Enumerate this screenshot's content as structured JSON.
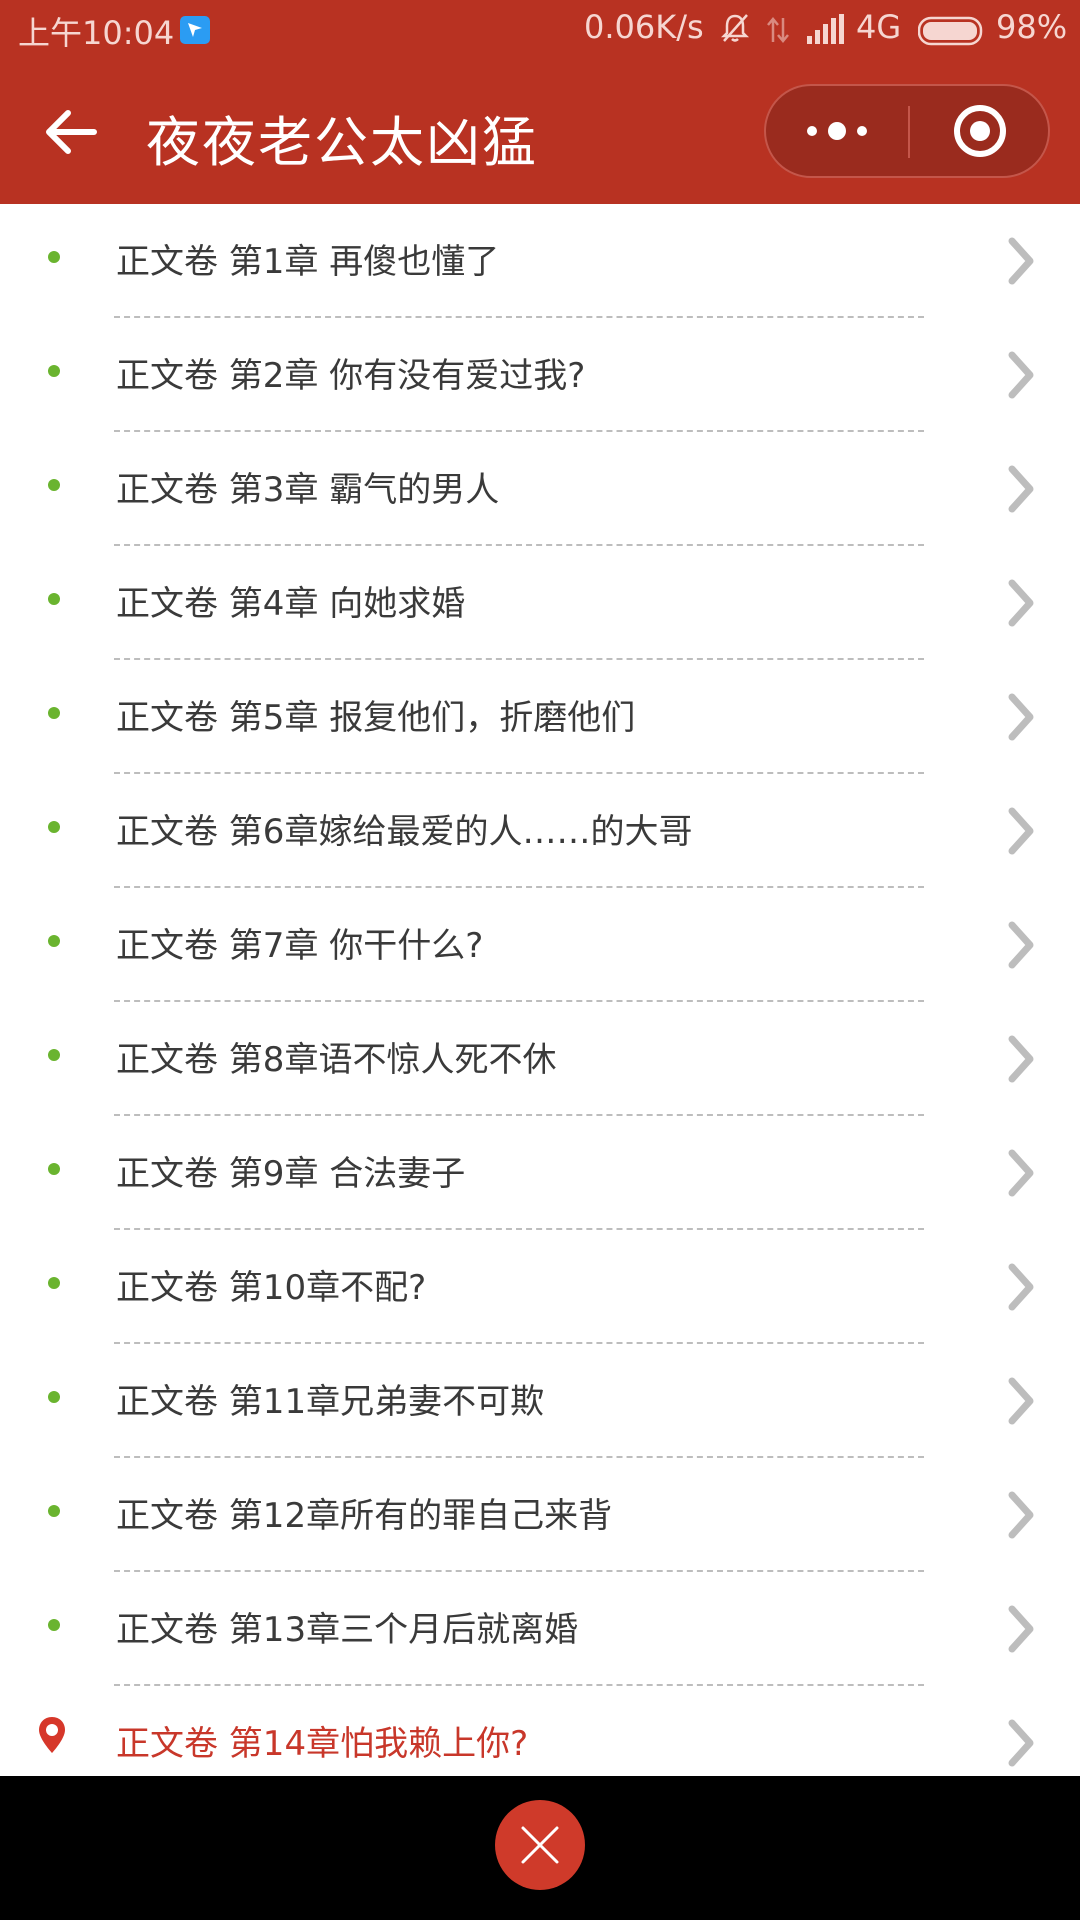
{
  "status_bar": {
    "time": "上午10:04",
    "network_speed": "0.06K/s",
    "network_type": "4G",
    "battery": "98%",
    "icons": [
      "notification-app-icon",
      "mute-bell-icon",
      "data-arrows-icon",
      "signal-bars-icon",
      "battery-icon"
    ]
  },
  "title_bar": {
    "title": "夜夜老公太凶猛",
    "back_icon": "back-arrow-icon",
    "more_icon": "more-dots-icon",
    "close_icon": "target-circle-icon"
  },
  "chapters": [
    {
      "title": "正文卷 第1章 再傻也懂了",
      "current": false
    },
    {
      "title": "正文卷 第2章 你有没有爱过我?",
      "current": false
    },
    {
      "title": "正文卷 第3章 霸气的男人",
      "current": false
    },
    {
      "title": "正文卷 第4章 向她求婚",
      "current": false
    },
    {
      "title": "正文卷 第5章 报复他们，折磨他们",
      "current": false
    },
    {
      "title": "正文卷 第6章嫁给最爱的人……的大哥",
      "current": false
    },
    {
      "title": "正文卷 第7章 你干什么?",
      "current": false
    },
    {
      "title": "正文卷 第8章语不惊人死不休",
      "current": false
    },
    {
      "title": "正文卷 第9章 合法妻子",
      "current": false
    },
    {
      "title": "正文卷 第10章不配?",
      "current": false
    },
    {
      "title": "正文卷 第11章兄弟妻不可欺",
      "current": false
    },
    {
      "title": "正文卷 第12章所有的罪自己来背",
      "current": false
    },
    {
      "title": "正文卷 第13章三个月后就离婚",
      "current": false
    },
    {
      "title": "正文卷 第14章怕我赖上你?",
      "current": true
    }
  ],
  "colors": {
    "brand": "#b83222",
    "bullet": "#6ab42f",
    "current_chapter": "#c8372a",
    "text": "#3a3a3a",
    "bottom_bar": "#000000",
    "close_button": "#cf3a2a"
  },
  "bottom_bar": {
    "close_icon": "close-x-icon"
  }
}
